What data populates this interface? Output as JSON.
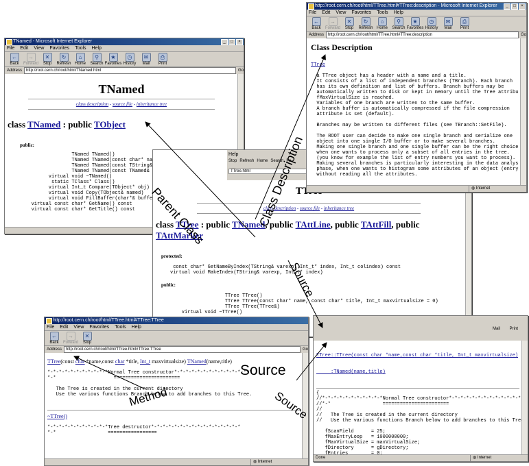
{
  "menu": [
    "File",
    "Edit",
    "View",
    "Favorites",
    "Tools",
    "Help"
  ],
  "toolbar": {
    "back": "Back",
    "forward": "Forward",
    "stop": "Stop",
    "refresh": "Refresh",
    "home": "Home",
    "search": "Search",
    "favorites": "Favorites",
    "history": "History",
    "mail": "Mail",
    "print": "Print"
  },
  "address_label": "Address",
  "go_label": "Go",
  "status_internet": "Internet",
  "status_done": "Done",
  "tnamed": {
    "title": "TNamed - Microsoft Internet Explorer",
    "url": "http://root.cern.ch/root/html/TNamed.html",
    "heading": "TNamed",
    "links": {
      "desc": "class description",
      "sep": " - ",
      "source": "source file",
      "sep2": " - ",
      "inherit": "inheritance tree"
    },
    "class_kw": "class ",
    "class_name": "TNamed",
    "class_sep": " : public ",
    "class_base": "TObject",
    "public_label": "public:",
    "members": [
      "                 TNamed TNamed()",
      "                 TNamed TNamed(const char* name, const char* title)",
      "                 TNamed TNamed(const TString& name, const TString& tit",
      "                 TNamed TNamed(const TNamed& named)",
      "         virtual void ~TNamed()",
      "          static TClass* Class()",
      "         virtual Int_t Compare(TObject* obj)",
      "         virtual void Copy(TObject& named)",
      "         virtual void FillBuffer(char*& buffer)",
      "   virtual const char* GetName() const",
      "   virtual const char* GetTitle() const"
    ]
  },
  "desc": {
    "title": "http://root.cern.ch/root/html/TTree.html#TTree:description - Microsoft Internet Explorer",
    "url": "http://root.cern.ch/root/html/TTree.html#TTree:description",
    "heading": "Class Description",
    "link": "TTree",
    "text": [
      "  a TTree object has a header with a name and a title.",
      "  It consists of a list of independent branches (TBranch). Each branch",
      "  has its own definition and list of buffers. Branch buffers may be",
      "  automatically written to disk or kept in memory until the Tree attribu",
      "  fMaxVirtualSize is reached.",
      "  Variables of one branch are written to the same buffer.",
      "  A branch buffer is automatically compressed if the file compression",
      "  attribute is set (default).",
      "",
      "  Branches may be written to different files (see TBranch::SetFile).",
      "",
      "  The ROOT user can decide to make one single branch and serialize one",
      "  object into one single I/O buffer or to make several branches.",
      "  Making one single branch and one single buffer can be the right choice",
      "  when one wants to process only a subset of all entries in the tree.",
      "  (you know for example the list of entry numbers you want to process).",
      "  Making several branches is particularly interesting in the data analys",
      "  phase, when one wants to histogram some attributes of an object (entry",
      "  without reading all the attributes."
    ]
  },
  "ttree": {
    "partial_menu": "Help",
    "partial_tb": [
      "Stop",
      "Refresh",
      "Home",
      "Search",
      "Fa"
    ],
    "partial_url": "TTree.html",
    "heading": "TTree",
    "links": {
      "desc": "class description",
      "sep": " - ",
      "source": "source file",
      "sep2": " - ",
      "inherit": "inheritance tree"
    },
    "class_kw": "class ",
    "class_name": "TTree",
    "p1": " : public ",
    "b1": "TNamed",
    "p2": ", public ",
    "b2": "TAttLine",
    "p3": ", public ",
    "b3": "TAttFill",
    "p4": ", public ",
    "b4": "TAttMarker",
    "protected_label": "protected:",
    "protected": [
      "      const char* GetNameByIndex(TString& varexp, Int_t* index, Int_t colindex) const",
      "     virtual void MakeIndex(TString& varexp, Int_t* index)"
    ],
    "public_label": "public:",
    "public": [
      "                        TTree TTree()",
      "                        TTree TTree(const char* name, const char* title, Int_t maxvirtualsize = 0)",
      "                        TTree TTree(TTree&)",
      "         virtual void ~TTree()"
    ]
  },
  "method": {
    "title": "http://root.cern.ch/root/html/TTree.html#TTree:TTree",
    "url": "http://root.cern.ch/root/html/TTree.html#TTree:TTree",
    "sig_a": "TTree",
    "sig_b": "(const ",
    "sig_c": "char",
    "sig_d": " *name,const ",
    "sig_e": "char",
    "sig_f": " *title, ",
    "sig_g": "Int_t",
    "sig_h": " maxvirtualsize) ",
    "sig_i": "TNamed",
    "sig_j": "(name,title)",
    "body": [
      "*-*-*-*-*-*-*-*-*-*-*Normal Tree constructor*-*-*-*-*-*-*-*-*-*-*-*-*-*",
      "*-*                    =======================",
      "",
      "   The Tree is created in the current directory",
      "   Use the various functions Branch below to add branches to this Tree.",
      "",
      ""
    ],
    "dtor": "~TTree()",
    "body2": [
      "*-*-*-*-*-*-*-*-*-*-*Tree destructor*-*-*-*-*-*-*-*-*-*-*-*-*-*-*-*",
      "*-*                  ================="
    ]
  },
  "source": {
    "frag_a": "Mail",
    "frag_b": "Print",
    "head1": "TTree::TTree(const char *name,const char *title, Int_t maxvirtualsize)",
    "head2": "     :TNamed(name,title)",
    "code": [
      "{",
      "//*-*-*-*-*-*-*-*-*-*-*Normal Tree constructor*-*-*-*-*-*-*-*-*-*-*-*-*",
      "//*-*                  =======================",
      "//",
      "//   The Tree is created in the current directory",
      "//   Use the various functions Branch below to add branches to this Tree.",
      "",
      "   fScanField      = 25;",
      "   fMaxEntryLoop   = 1000000000;",
      "   fMaxVirtualSize = maxVirtualSize;",
      "   fDirectory      = gDirectory;",
      "   fEntries        = 0;"
    ]
  },
  "annotations": {
    "parent": "Parent Class",
    "classdesc": "Class Description",
    "source1": "Source",
    "source2": "Source",
    "method": "Method",
    "source_big": "Source"
  }
}
